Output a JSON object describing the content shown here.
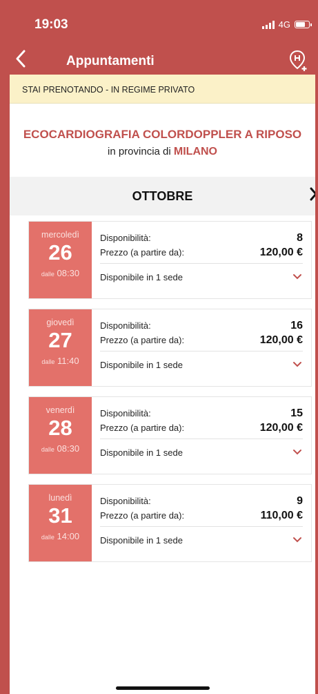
{
  "statusbar": {
    "time": "19:03",
    "network": "4G"
  },
  "nav": {
    "title": "Appuntamenti",
    "back_icon": "chevron-left-icon",
    "action_icon": "location-pin-plus-icon"
  },
  "banner": {
    "text": "STAI PRENOTANDO - IN REGIME PRIVATO"
  },
  "exam": {
    "title": "ECOCARDIOGRAFIA COLORDOPPLER A RIPOSO",
    "province_prefix": "in provincia di",
    "city": "MILANO"
  },
  "month": {
    "label": "OTTOBRE"
  },
  "labels": {
    "availability": "Disponibilità:",
    "price": "Prezzo (a partire da):",
    "from": "dalle"
  },
  "slots": [
    {
      "weekday": "mercoledì",
      "day": "26",
      "time": "08:30",
      "availability": "8",
      "price": "120,00 €",
      "locations": "Disponibile in 1 sede"
    },
    {
      "weekday": "giovedì",
      "day": "27",
      "time": "11:40",
      "availability": "16",
      "price": "120,00 €",
      "locations": "Disponibile in 1 sede"
    },
    {
      "weekday": "venerdì",
      "day": "28",
      "time": "08:30",
      "availability": "15",
      "price": "120,00 €",
      "locations": "Disponibile in 1 sede"
    },
    {
      "weekday": "lunedì",
      "day": "31",
      "time": "14:00",
      "availability": "9",
      "price": "110,00 €",
      "locations": "Disponibile in 1 sede"
    }
  ],
  "colors": {
    "brand": "#c0504d",
    "date_box": "#e3716a",
    "banner": "#fbf1c8"
  }
}
